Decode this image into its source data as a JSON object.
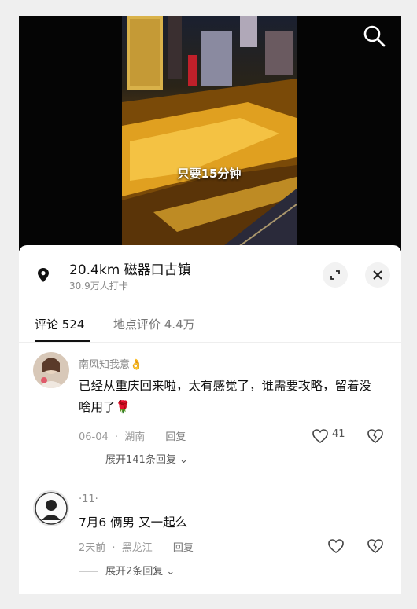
{
  "video": {
    "caption": "只要15分钟",
    "icons": {
      "search": "search-icon"
    }
  },
  "location": {
    "title": "20.4km  磁器口古镇",
    "checkins": "30.9万人打卡",
    "icons": {
      "pin": "location-pin-icon",
      "expand": "expand-icon",
      "close": "close-icon"
    }
  },
  "tabs": {
    "comments": "评论 524",
    "reviews": "地点评价 4.4万"
  },
  "comments": [
    {
      "user": "南风知我意👌",
      "text": "已经从重庆回来啦，太有感觉了，谁需要攻略，留着没啥用了🌹",
      "date": "06-04",
      "region": "湖南",
      "reply": "回复",
      "likes": "41",
      "expand": "展开141条回复 ⌄"
    },
    {
      "user": "·11·",
      "text": "7月6 俩男 又一起么",
      "date": "2天前",
      "region": "黑龙江",
      "reply": "回复",
      "likes": "",
      "expand": "展开2条回复 ⌄"
    }
  ],
  "colors": {
    "sheet": "#ffffff",
    "accent": "#111111",
    "muted": "#999999"
  }
}
